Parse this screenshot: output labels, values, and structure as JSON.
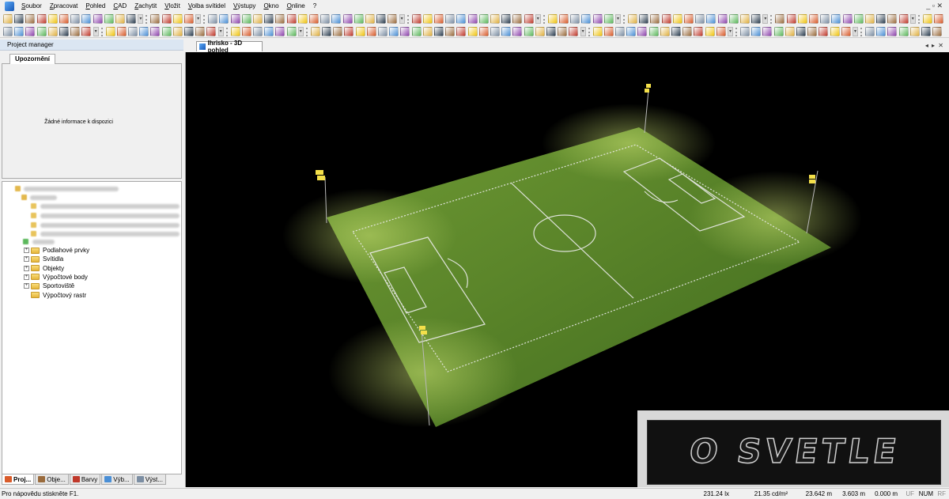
{
  "menu": {
    "items": [
      "Soubor",
      "Zpracovat",
      "Pohled",
      "CAD",
      "Zachytit",
      "Vložit",
      "Volba svítidel",
      "Výstupy",
      "Okno",
      "Online",
      "?"
    ]
  },
  "colors": {
    "field_green": "#5e8a2a",
    "accent": "#3a7bd5",
    "panel_header": "#dbe6f2"
  },
  "left_panel": {
    "title": "Project manager",
    "notice_tab": "Upozornění",
    "notice_text": "Žádné informace k dispozici",
    "tree": [
      {
        "label": "Podlahové prvky",
        "expandable": true
      },
      {
        "label": "Svítidla",
        "expandable": true
      },
      {
        "label": "Objekty",
        "expandable": true
      },
      {
        "label": "Výpočtové body",
        "expandable": true
      },
      {
        "label": "Sportoviště",
        "expandable": true
      },
      {
        "label": "Výpočtový rastr",
        "expandable": false
      }
    ],
    "tabs": [
      {
        "label": "Proj...",
        "icon": "project-icon",
        "color": "#d95b2a",
        "active": true
      },
      {
        "label": "Obje...",
        "icon": "objects-icon",
        "color": "#9a6b3c",
        "active": false
      },
      {
        "label": "Barvy",
        "icon": "colors-icon",
        "color": "#c0392b",
        "active": false
      },
      {
        "label": "Výb...",
        "icon": "selection-icon",
        "color": "#4a8fd6",
        "active": false
      },
      {
        "label": "Výst...",
        "icon": "outputs-icon",
        "color": "#7c8ea3",
        "active": false
      }
    ]
  },
  "document": {
    "tab_title": "Ihrisko - 3D pohled",
    "watermark": "O SVETLE"
  },
  "status": {
    "help": "Pro nápovědu stiskněte F1.",
    "illuminance": "231.24 lx",
    "luminance": "21.35 cd/m²",
    "x": "23.642 m",
    "y": "3.603 m",
    "z": "0.000 m",
    "uf": "UF",
    "num": "NUM",
    "rf": "RF"
  }
}
